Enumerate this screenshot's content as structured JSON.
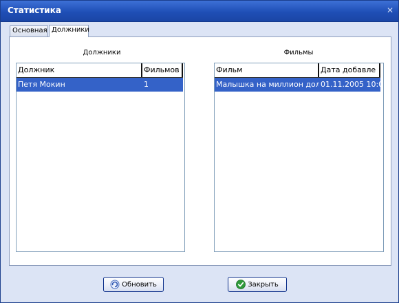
{
  "window": {
    "title": "Статистика"
  },
  "tabs": [
    {
      "label": "Основная",
      "active": false
    },
    {
      "label": "Должники",
      "active": true
    }
  ],
  "debtors": {
    "title": "Должники",
    "columns": [
      "Должник",
      "Фильмов"
    ],
    "rows": [
      [
        "Петя Мокин",
        "1"
      ]
    ]
  },
  "films": {
    "title": "Фильмы",
    "columns": [
      "Фильм",
      "Дата добавле"
    ],
    "rows": [
      [
        "Малышка на миллион дол",
        "01.11.2005 10:0"
      ]
    ]
  },
  "buttons": {
    "refresh_label": "Обновить",
    "close_label": "Закрыть"
  },
  "colors": {
    "titlebar": "#2454c0",
    "selection": "#3462c8",
    "window_bg": "#dce4f5"
  },
  "icons": {
    "close": "close-icon",
    "refresh": "refresh-icon",
    "check": "check-icon"
  }
}
